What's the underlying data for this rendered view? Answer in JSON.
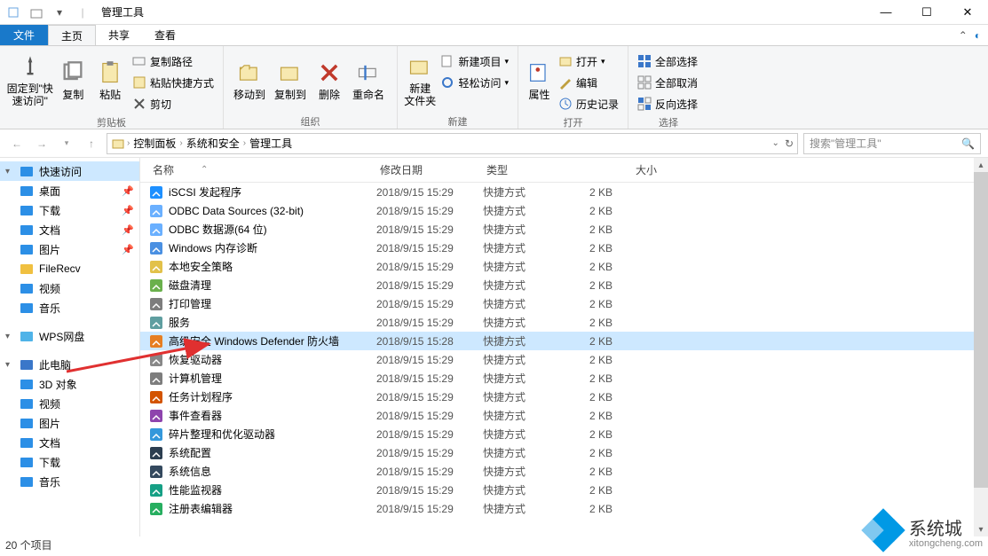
{
  "title": "管理工具",
  "qat": [
    "properties-icon",
    "new-folder-icon",
    "dropdown-icon"
  ],
  "ribbon": {
    "fileTab": "文件",
    "tabs": [
      {
        "label": "主页",
        "active": true
      },
      {
        "label": "共享"
      },
      {
        "label": "查看"
      }
    ],
    "groups": {
      "clipboard": {
        "label": "剪贴板",
        "pin": "固定到\"快\n速访问\"",
        "copy": "复制",
        "paste": "粘贴",
        "pastePath": "复制路径",
        "pasteShortcut": "粘贴快捷方式",
        "cut": "剪切"
      },
      "organize": {
        "label": "组织",
        "moveTo": "移动到",
        "copyTo": "复制到",
        "delete": "删除",
        "rename": "重命名"
      },
      "new": {
        "label": "新建",
        "newFolder": "新建\n文件夹",
        "newItem": "新建项目",
        "easyAccess": "轻松访问"
      },
      "open": {
        "label": "打开",
        "properties": "属性",
        "open": "打开",
        "edit": "编辑",
        "history": "历史记录"
      },
      "select": {
        "label": "选择",
        "all": "全部选择",
        "none": "全部取消",
        "invert": "反向选择"
      }
    }
  },
  "nav": {
    "crumbs": [
      "控制面板",
      "系统和安全",
      "管理工具"
    ]
  },
  "search": {
    "placeholder": "搜索\"管理工具\""
  },
  "columns": {
    "name": "名称",
    "date": "修改日期",
    "type": "类型",
    "size": "大小"
  },
  "files": [
    {
      "name": "iSCSI 发起程序",
      "date": "2018/9/15 15:29",
      "type": "快捷方式",
      "size": "2 KB",
      "icon": "#1e90ff"
    },
    {
      "name": "ODBC Data Sources (32-bit)",
      "date": "2018/9/15 15:29",
      "type": "快捷方式",
      "size": "2 KB",
      "icon": "#6ab0ff"
    },
    {
      "name": "ODBC 数据源(64 位)",
      "date": "2018/9/15 15:29",
      "type": "快捷方式",
      "size": "2 KB",
      "icon": "#6ab0ff"
    },
    {
      "name": "Windows 内存诊断",
      "date": "2018/9/15 15:29",
      "type": "快捷方式",
      "size": "2 KB",
      "icon": "#4a90e2"
    },
    {
      "name": "本地安全策略",
      "date": "2018/9/15 15:29",
      "type": "快捷方式",
      "size": "2 KB",
      "icon": "#e2c14a"
    },
    {
      "name": "磁盘清理",
      "date": "2018/9/15 15:29",
      "type": "快捷方式",
      "size": "2 KB",
      "icon": "#6ab04c"
    },
    {
      "name": "打印管理",
      "date": "2018/9/15 15:29",
      "type": "快捷方式",
      "size": "2 KB",
      "icon": "#7d7d7d"
    },
    {
      "name": "服务",
      "date": "2018/9/15 15:29",
      "type": "快捷方式",
      "size": "2 KB",
      "icon": "#5f9ea0"
    },
    {
      "name": "高级安全 Windows Defender 防火墙",
      "date": "2018/9/15 15:28",
      "type": "快捷方式",
      "size": "2 KB",
      "icon": "#e67e22",
      "selected": true
    },
    {
      "name": "恢复驱动器",
      "date": "2018/9/15 15:29",
      "type": "快捷方式",
      "size": "2 KB",
      "icon": "#888"
    },
    {
      "name": "计算机管理",
      "date": "2018/9/15 15:29",
      "type": "快捷方式",
      "size": "2 KB",
      "icon": "#7d7d7d"
    },
    {
      "name": "任务计划程序",
      "date": "2018/9/15 15:29",
      "type": "快捷方式",
      "size": "2 KB",
      "icon": "#d35400"
    },
    {
      "name": "事件查看器",
      "date": "2018/9/15 15:29",
      "type": "快捷方式",
      "size": "2 KB",
      "icon": "#8e44ad"
    },
    {
      "name": "碎片整理和优化驱动器",
      "date": "2018/9/15 15:29",
      "type": "快捷方式",
      "size": "2 KB",
      "icon": "#3498db"
    },
    {
      "name": "系统配置",
      "date": "2018/9/15 15:29",
      "type": "快捷方式",
      "size": "2 KB",
      "icon": "#2c3e50"
    },
    {
      "name": "系统信息",
      "date": "2018/9/15 15:29",
      "type": "快捷方式",
      "size": "2 KB",
      "icon": "#34495e"
    },
    {
      "name": "性能监视器",
      "date": "2018/9/15 15:29",
      "type": "快捷方式",
      "size": "2 KB",
      "icon": "#16a085"
    },
    {
      "name": "注册表编辑器",
      "date": "2018/9/15 15:29",
      "type": "快捷方式",
      "size": "2 KB",
      "icon": "#27ae60"
    }
  ],
  "sidebar": [
    {
      "label": "快速访问",
      "icon": "#2c8fe6",
      "caret": true,
      "selected": true,
      "type": "star"
    },
    {
      "label": "桌面",
      "icon": "#2c8fe6",
      "pin": true,
      "type": "desktop"
    },
    {
      "label": "下载",
      "icon": "#2c8fe6",
      "pin": true,
      "type": "download"
    },
    {
      "label": "文档",
      "icon": "#2c8fe6",
      "pin": true,
      "type": "document"
    },
    {
      "label": "图片",
      "icon": "#2c8fe6",
      "pin": true,
      "type": "picture"
    },
    {
      "label": "FileRecv",
      "icon": "#f0c040",
      "type": "folder"
    },
    {
      "label": "视频",
      "icon": "#2c8fe6",
      "type": "video"
    },
    {
      "label": "音乐",
      "icon": "#2c8fe6",
      "type": "music"
    },
    {
      "spacer": true
    },
    {
      "label": "WPS网盘",
      "icon": "#4fb3e8",
      "caret": true,
      "type": "cloud"
    },
    {
      "spacer": true
    },
    {
      "label": "此电脑",
      "icon": "#3a77c9",
      "caret": true,
      "type": "pc"
    },
    {
      "label": "3D 对象",
      "icon": "#2c8fe6",
      "type": "3d"
    },
    {
      "label": "视频",
      "icon": "#2c8fe6",
      "type": "video"
    },
    {
      "label": "图片",
      "icon": "#2c8fe6",
      "type": "picture"
    },
    {
      "label": "文档",
      "icon": "#2c8fe6",
      "type": "document"
    },
    {
      "label": "下载",
      "icon": "#2c8fe6",
      "type": "download"
    },
    {
      "label": "音乐",
      "icon": "#2c8fe6",
      "type": "music"
    }
  ],
  "status": "20 个项目",
  "watermark": {
    "brand": "系统城",
    "url": "xitongcheng.com"
  }
}
